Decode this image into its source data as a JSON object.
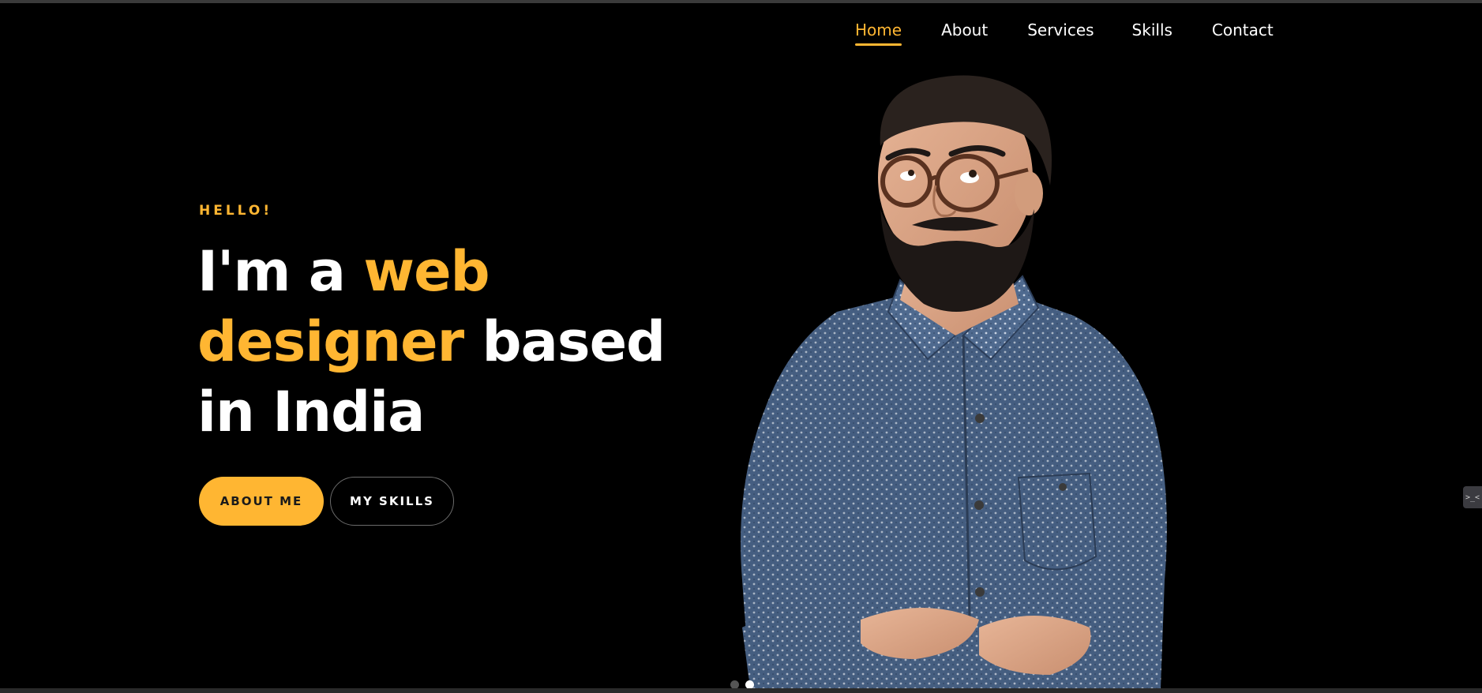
{
  "nav": {
    "items": [
      {
        "label": "Home",
        "active": true
      },
      {
        "label": "About",
        "active": false
      },
      {
        "label": "Services",
        "active": false
      },
      {
        "label": "Skills",
        "active": false
      },
      {
        "label": "Contact",
        "active": false
      }
    ]
  },
  "hero": {
    "greeting": "HELLO!",
    "headline": {
      "part1": "I'm a ",
      "accent1": "web",
      "accent2": "designer",
      "part2": " based",
      "part3": "in India"
    },
    "buttons": {
      "primary_label": "ABOUT ME",
      "secondary_label": "MY SKILLS"
    },
    "portrait_icon": "man-with-glasses-portrait"
  },
  "slider": {
    "dot_count": 2,
    "active_index": 1
  },
  "side_widget": {
    "icon": "terminal-icon",
    "label": ">_<"
  },
  "colors": {
    "background": "#000000",
    "accent": "#ffb632",
    "text": "#ffffff",
    "shirt": "#4a6184"
  }
}
